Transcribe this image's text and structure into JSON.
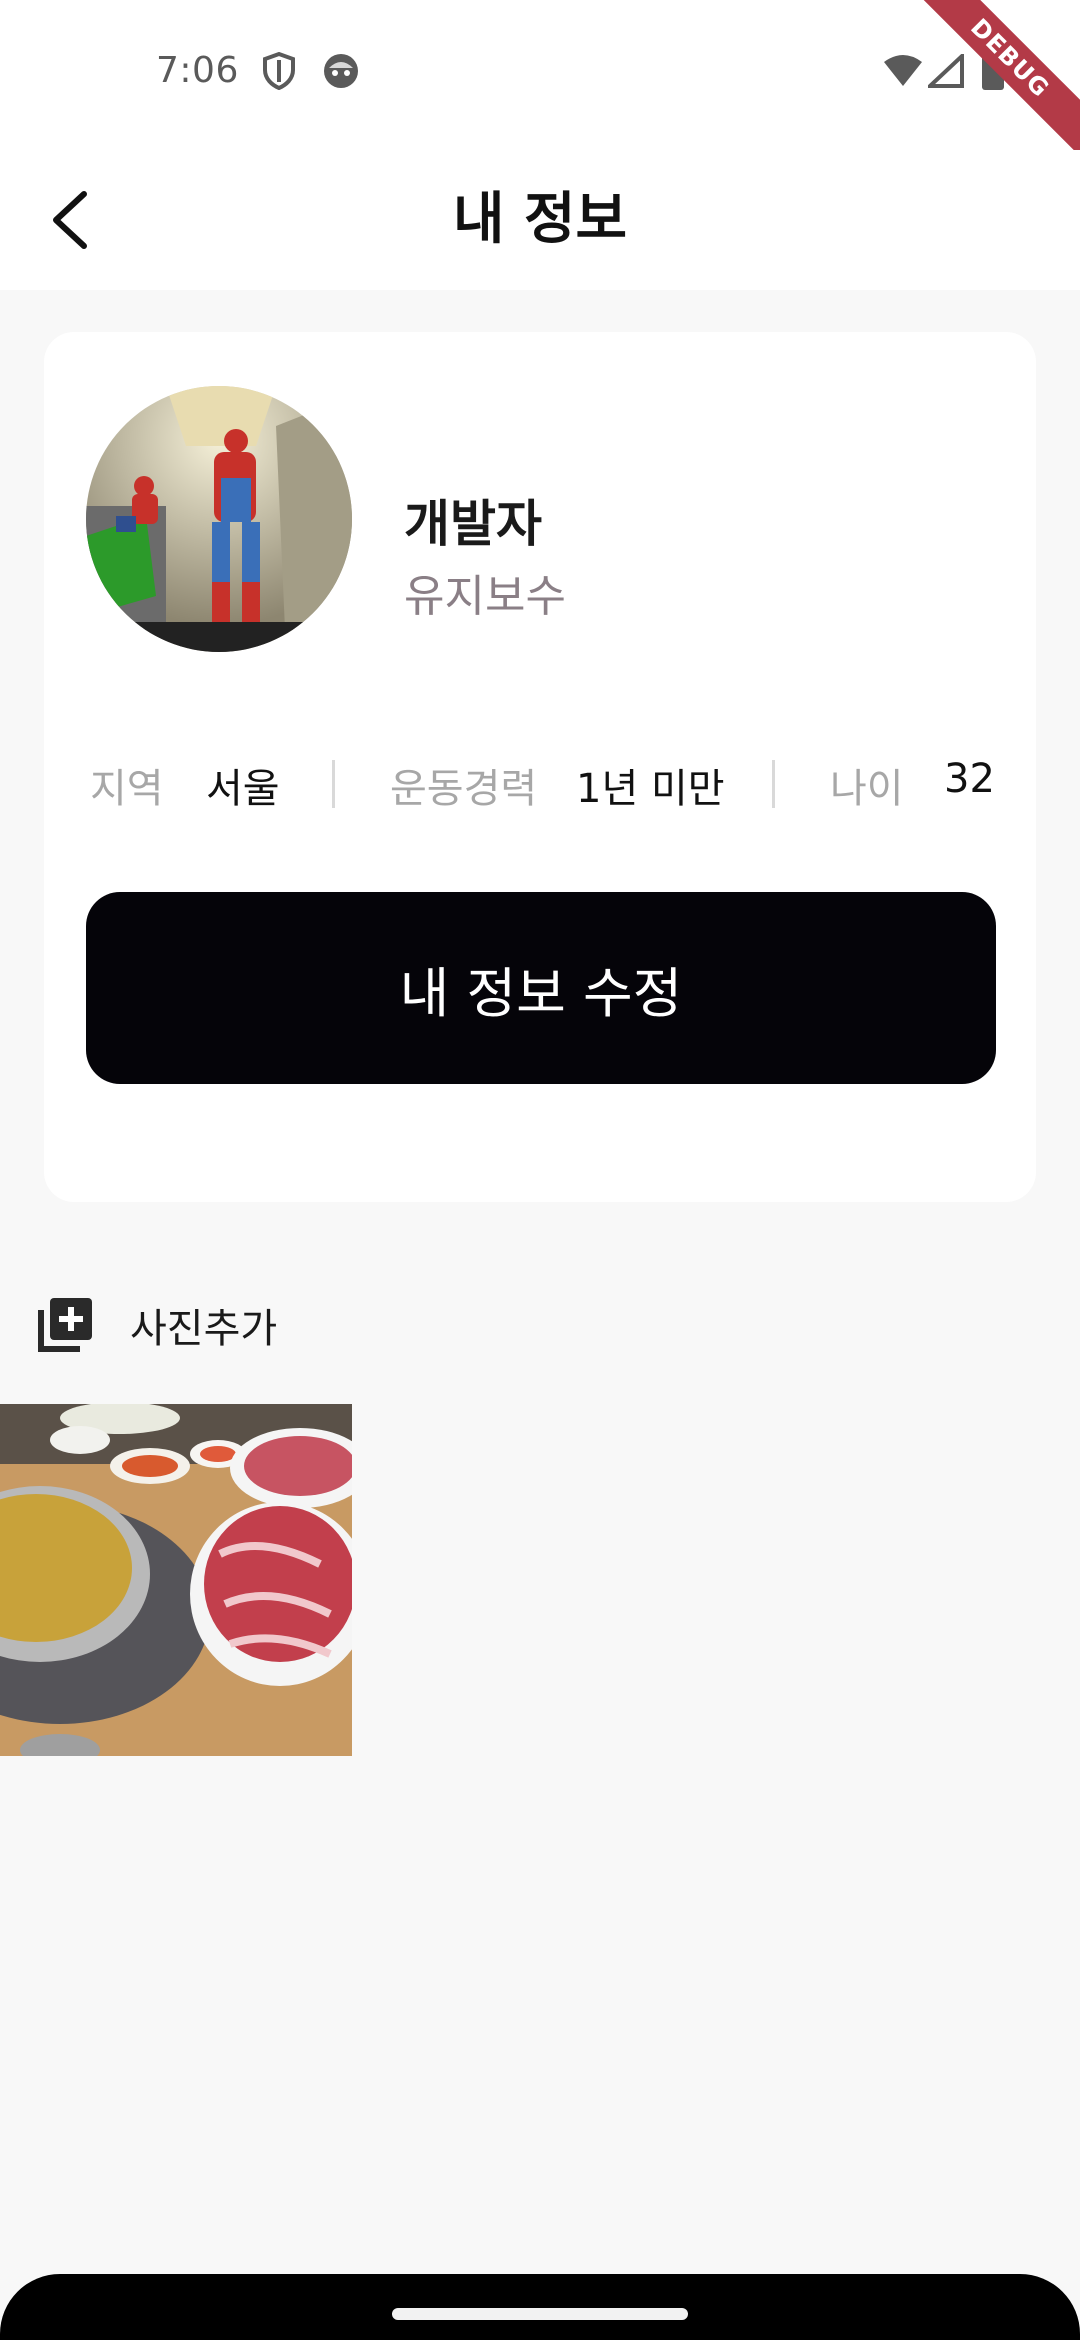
{
  "status_bar": {
    "time": "7:06",
    "icons": [
      "shield-icon",
      "face-icon",
      "wifi-icon",
      "signal-icon",
      "battery-icon"
    ]
  },
  "debug_ribbon": "DEBUG",
  "app_bar": {
    "title": "내 정보",
    "back_icon": "back-arrow-icon"
  },
  "profile": {
    "name": "개발자",
    "status": "유지보수",
    "avatar_icon": "profile-photo"
  },
  "info": {
    "region_label": "지역",
    "region_value": "서울",
    "career_label": "운동경력",
    "career_value": "1년 미만",
    "age_label": "나이",
    "age_value": "32"
  },
  "edit_button_label": "내 정보 수정",
  "add_photo_label": "사진추가",
  "colors": {
    "background": "#f8f8f8",
    "card": "#ffffff",
    "button": "#050409",
    "muted_text": "#a7a7a7",
    "status_text": "#8a7f86",
    "debug_ribbon": "#b33a47"
  }
}
